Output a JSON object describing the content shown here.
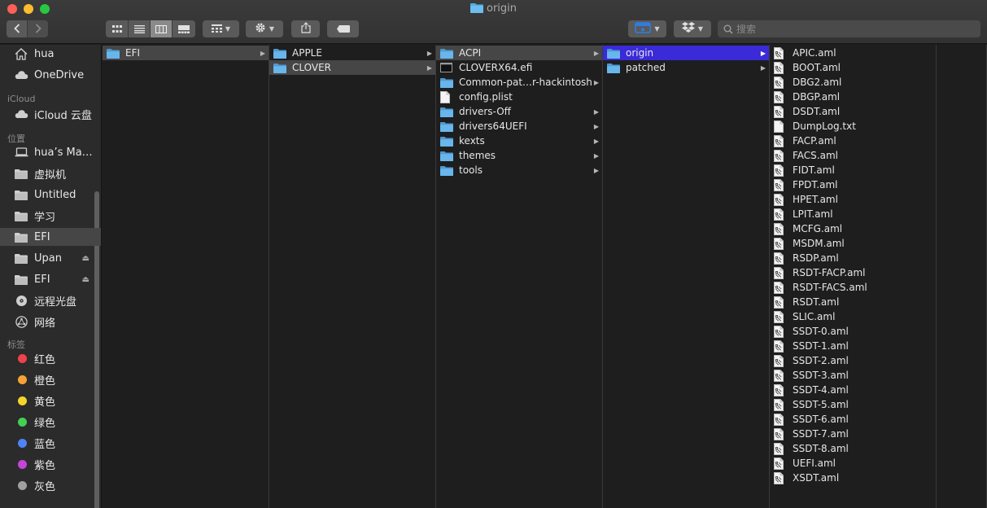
{
  "window": {
    "title": "origin"
  },
  "toolbar": {
    "search_placeholder": "搜索"
  },
  "sidebar": {
    "favorites": [
      {
        "label": "hua",
        "icon": "home-icon"
      },
      {
        "label": "OneDrive",
        "icon": "cloud-icon"
      }
    ],
    "icloud_header": "iCloud",
    "icloud": [
      {
        "label": "iCloud 云盘",
        "icon": "cloud-icon"
      }
    ],
    "locations_header": "位置",
    "locations": [
      {
        "label": "hua’s Ma…",
        "icon": "laptop-icon"
      },
      {
        "label": "虚拟机",
        "icon": "folder-icon"
      },
      {
        "label": "Untitled",
        "icon": "folder-icon"
      },
      {
        "label": "学习",
        "icon": "folder-icon"
      },
      {
        "label": "EFI",
        "icon": "folder-icon",
        "selected": true
      },
      {
        "label": "Upan",
        "icon": "folder-icon",
        "eject": true
      },
      {
        "label": "EFI",
        "icon": "folder-icon",
        "eject": true
      },
      {
        "label": "远程光盘",
        "icon": "disc-icon"
      },
      {
        "label": "网络",
        "icon": "network-icon"
      }
    ],
    "tags_header": "标签",
    "tags": [
      {
        "label": "红色",
        "color": "#f0424b"
      },
      {
        "label": "橙色",
        "color": "#f6a336"
      },
      {
        "label": "黄色",
        "color": "#f5d52c"
      },
      {
        "label": "绿色",
        "color": "#43cf51"
      },
      {
        "label": "蓝色",
        "color": "#4e82f6"
      },
      {
        "label": "紫色",
        "color": "#c445d8"
      },
      {
        "label": "灰色",
        "color": "#a0a0a0"
      }
    ]
  },
  "columns": [
    {
      "items": [
        {
          "label": "EFI",
          "type": "folder",
          "arrow": true,
          "selected": "gray"
        }
      ]
    },
    {
      "items": [
        {
          "label": "APPLE",
          "type": "folder",
          "arrow": true
        },
        {
          "label": "CLOVER",
          "type": "folder",
          "arrow": true,
          "selected": "gray"
        }
      ]
    },
    {
      "items": [
        {
          "label": "ACPI",
          "type": "folder",
          "arrow": true,
          "selected": "gray"
        },
        {
          "label": "CLOVERX64.efi",
          "type": "exec"
        },
        {
          "label": "Common-pat…r-hackintosh",
          "type": "folder",
          "arrow": true
        },
        {
          "label": "config.plist",
          "type": "doc"
        },
        {
          "label": "drivers-Off",
          "type": "folder",
          "arrow": true
        },
        {
          "label": "drivers64UEFI",
          "type": "folder",
          "arrow": true
        },
        {
          "label": "kexts",
          "type": "folder",
          "arrow": true
        },
        {
          "label": "themes",
          "type": "folder",
          "arrow": true
        },
        {
          "label": "tools",
          "type": "folder",
          "arrow": true
        }
      ]
    },
    {
      "items": [
        {
          "label": "origin",
          "type": "folder",
          "arrow": true,
          "selected": "blue"
        },
        {
          "label": "patched",
          "type": "folder",
          "arrow": true
        }
      ]
    },
    {
      "items": [
        {
          "label": "APIC.aml",
          "type": "aml"
        },
        {
          "label": "BOOT.aml",
          "type": "aml"
        },
        {
          "label": "DBG2.aml",
          "type": "aml"
        },
        {
          "label": "DBGP.aml",
          "type": "aml"
        },
        {
          "label": "DSDT.aml",
          "type": "aml"
        },
        {
          "label": "DumpLog.txt",
          "type": "doc"
        },
        {
          "label": "FACP.aml",
          "type": "aml"
        },
        {
          "label": "FACS.aml",
          "type": "aml"
        },
        {
          "label": "FIDT.aml",
          "type": "aml"
        },
        {
          "label": "FPDT.aml",
          "type": "aml"
        },
        {
          "label": "HPET.aml",
          "type": "aml"
        },
        {
          "label": "LPIT.aml",
          "type": "aml"
        },
        {
          "label": "MCFG.aml",
          "type": "aml"
        },
        {
          "label": "MSDM.aml",
          "type": "aml"
        },
        {
          "label": "RSDP.aml",
          "type": "aml"
        },
        {
          "label": "RSDT-FACP.aml",
          "type": "aml"
        },
        {
          "label": "RSDT-FACS.aml",
          "type": "aml"
        },
        {
          "label": "RSDT.aml",
          "type": "aml"
        },
        {
          "label": "SLIC.aml",
          "type": "aml"
        },
        {
          "label": "SSDT-0.aml",
          "type": "aml"
        },
        {
          "label": "SSDT-1.aml",
          "type": "aml"
        },
        {
          "label": "SSDT-2.aml",
          "type": "aml"
        },
        {
          "label": "SSDT-3.aml",
          "type": "aml"
        },
        {
          "label": "SSDT-4.aml",
          "type": "aml"
        },
        {
          "label": "SSDT-5.aml",
          "type": "aml"
        },
        {
          "label": "SSDT-6.aml",
          "type": "aml"
        },
        {
          "label": "SSDT-7.aml",
          "type": "aml"
        },
        {
          "label": "SSDT-8.aml",
          "type": "aml"
        },
        {
          "label": "UEFI.aml",
          "type": "aml"
        },
        {
          "label": "XSDT.aml",
          "type": "aml"
        }
      ]
    }
  ]
}
